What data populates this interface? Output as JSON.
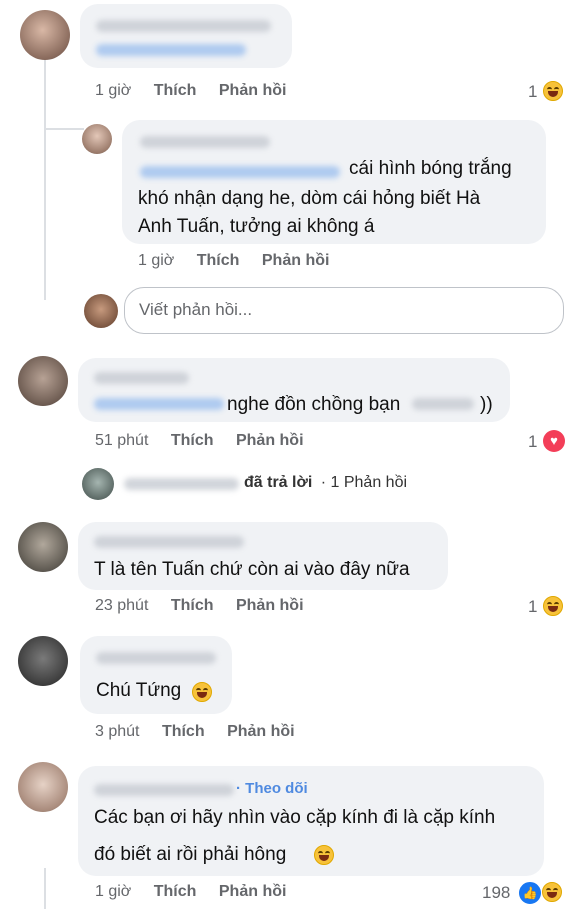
{
  "comments": [
    {
      "time": "1 giờ",
      "like": "Thích",
      "reply": "Phản hồi",
      "reaction_count": "1"
    },
    {
      "text_lines": [
        "cái hình bóng trắng",
        "khó nhận dạng he, dòm cái hỏng biết Hà",
        "Anh Tuấn, tưởng ai không á"
      ],
      "time": "1 giờ",
      "like": "Thích",
      "reply": "Phản hồi"
    },
    {
      "text": "nghe đồn chồng bạn",
      "text_end": "))",
      "time": "51 phút",
      "like": "Thích",
      "reply": "Phản hồi",
      "reaction_count": "1"
    },
    {
      "text": "T là tên Tuấn chứ còn ai vào đây nữa",
      "time": "23 phút",
      "like": "Thích",
      "reply": "Phản hồi",
      "reaction_count": "1"
    },
    {
      "text": "Chú Tứng",
      "time": "3 phút",
      "like": "Thích",
      "reply": "Phản hồi"
    },
    {
      "follow_label": "· Theo dõi",
      "text_lines": [
        "Các bạn ơi hãy nhìn vào cặp kính đi là cặp kính",
        "đó biết ai rồi phải hông"
      ],
      "time": "1 giờ",
      "like": "Thích",
      "reply": "Phản hồi",
      "reaction_count": "198"
    }
  ],
  "reply_input": {
    "placeholder": "Viết phản hồi..."
  },
  "replied_summary": {
    "action": "đã trả lời",
    "count": "· 1 Phản hồi"
  },
  "colors": {
    "bubble": "#f0f2f5",
    "meta": "#65676b",
    "like_blue": "#1877f2",
    "heart_red": "#f33e58"
  }
}
